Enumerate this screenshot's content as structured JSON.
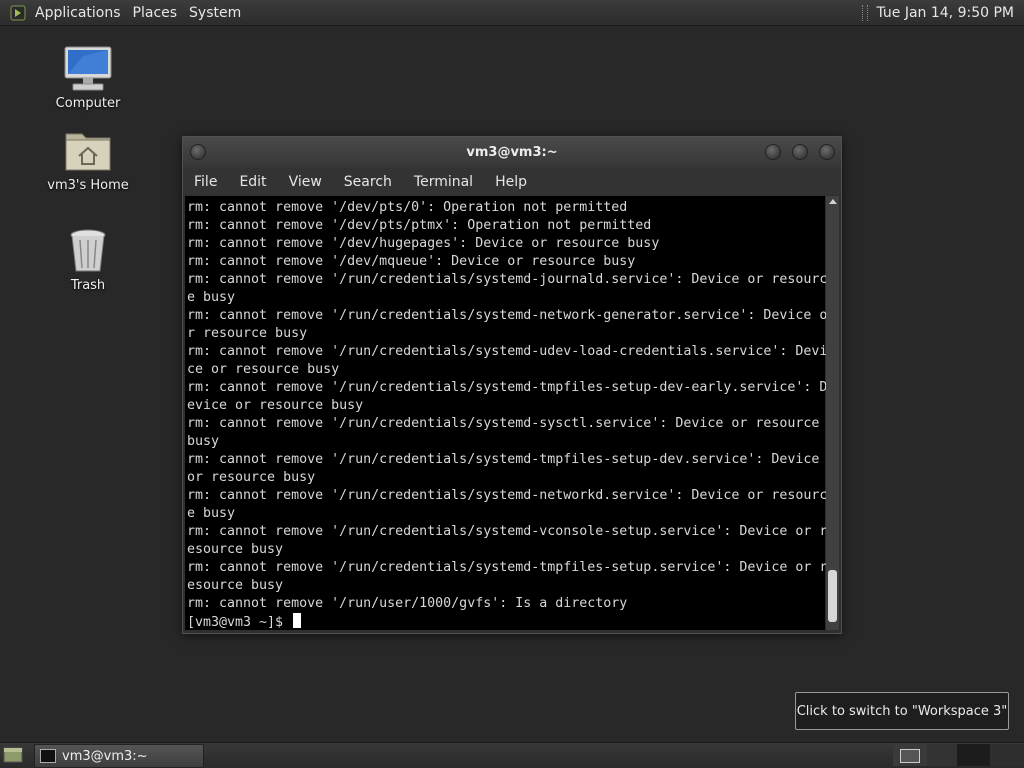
{
  "top_panel": {
    "menus": [
      "Applications",
      "Places",
      "System"
    ],
    "clock": "Tue Jan 14,  9:50 PM"
  },
  "desktop_icons": [
    {
      "label": "Computer",
      "icon": "computer-icon"
    },
    {
      "label": "vm3's Home",
      "icon": "home-folder-icon"
    },
    {
      "label": "Trash",
      "icon": "trash-icon"
    }
  ],
  "terminal": {
    "title": "vm3@vm3:~",
    "menus": [
      "File",
      "Edit",
      "View",
      "Search",
      "Terminal",
      "Help"
    ],
    "lines": [
      "rm: cannot remove '/dev/pts/0': Operation not permitted",
      "rm: cannot remove '/dev/pts/ptmx': Operation not permitted",
      "rm: cannot remove '/dev/hugepages': Device or resource busy",
      "rm: cannot remove '/dev/mqueue': Device or resource busy",
      "rm: cannot remove '/run/credentials/systemd-journald.service': Device or resourc",
      "e busy",
      "rm: cannot remove '/run/credentials/systemd-network-generator.service': Device o",
      "r resource busy",
      "rm: cannot remove '/run/credentials/systemd-udev-load-credentials.service': Devi",
      "ce or resource busy",
      "rm: cannot remove '/run/credentials/systemd-tmpfiles-setup-dev-early.service': D",
      "evice or resource busy",
      "rm: cannot remove '/run/credentials/systemd-sysctl.service': Device or resource",
      "busy",
      "rm: cannot remove '/run/credentials/systemd-tmpfiles-setup-dev.service': Device",
      "or resource busy",
      "rm: cannot remove '/run/credentials/systemd-networkd.service': Device or resourc",
      "e busy",
      "rm: cannot remove '/run/credentials/systemd-vconsole-setup.service': Device or r",
      "esource busy",
      "rm: cannot remove '/run/credentials/systemd-tmpfiles-setup.service': Device or r",
      "esource busy",
      "rm: cannot remove '/run/user/1000/gvfs': Is a directory"
    ],
    "prompt": "[vm3@vm3 ~]$ "
  },
  "tooltip": "Click to switch to \"Workspace 3\"",
  "taskbar": {
    "window_button": "vm3@vm3:~"
  }
}
